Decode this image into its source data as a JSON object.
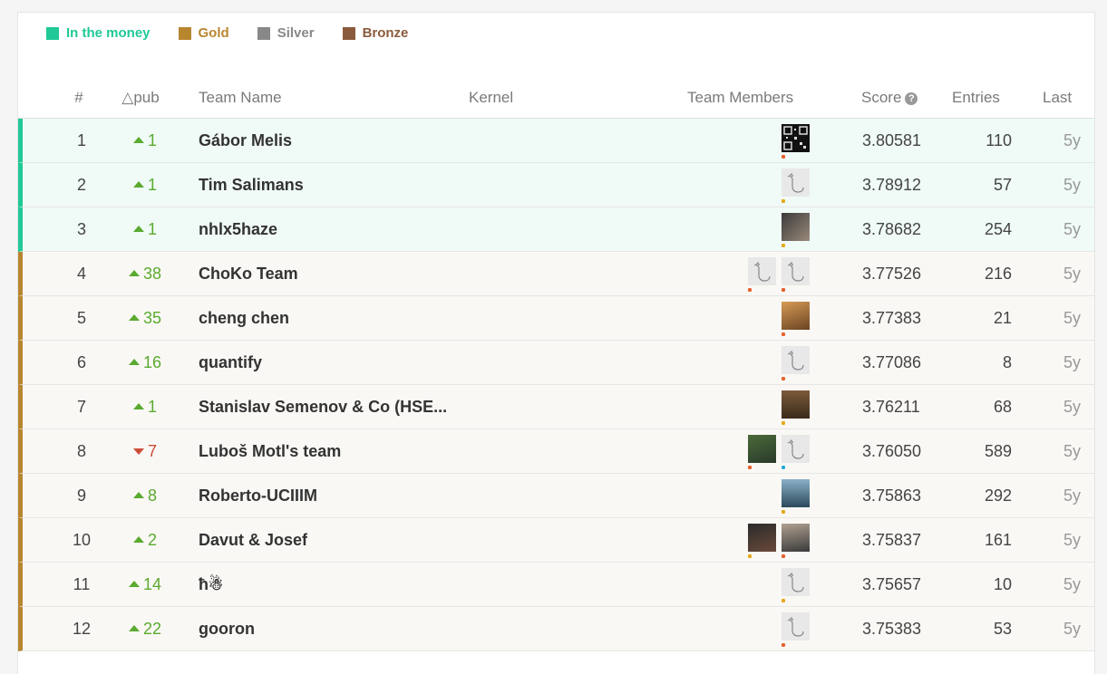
{
  "legend": [
    {
      "label": "In the money",
      "color": "#20c997"
    },
    {
      "label": "Gold",
      "color": "#b8862f"
    },
    {
      "label": "Silver",
      "color": "#888888"
    },
    {
      "label": "Bronze",
      "color": "#8b5a3c"
    }
  ],
  "header": {
    "rank": "#",
    "delta": "△pub",
    "team": "Team Name",
    "kernel": "Kernel",
    "members": "Team Members",
    "score": "Score",
    "score_help": "?",
    "entries": "Entries",
    "last": "Last"
  },
  "rows": [
    {
      "rank": "1",
      "delta": "1",
      "dir": "up",
      "team": "Gábor Melis",
      "score": "3.80581",
      "entries": "110",
      "last": "5y",
      "tier": "money",
      "avatars": [
        {
          "kind": "qr",
          "dots": "#e8602c"
        }
      ]
    },
    {
      "rank": "2",
      "delta": "1",
      "dir": "up",
      "team": "Tim Salimans",
      "score": "3.78912",
      "entries": "57",
      "last": "5y",
      "tier": "money",
      "avatars": [
        {
          "kind": "default",
          "dots": "#e6a817"
        }
      ]
    },
    {
      "rank": "3",
      "delta": "1",
      "dir": "up",
      "team": "nhlx5haze",
      "score": "3.78682",
      "entries": "254",
      "last": "5y",
      "tier": "money",
      "avatars": [
        {
          "kind": "photo1",
          "dots": "#e6a817"
        }
      ]
    },
    {
      "rank": "4",
      "delta": "38",
      "dir": "up",
      "team": "ChoKo Team",
      "score": "3.77526",
      "entries": "216",
      "last": "5y",
      "tier": "gold",
      "avatars": [
        {
          "kind": "default",
          "dots": "#e8602c"
        },
        {
          "kind": "default",
          "dots": "#e8602c"
        }
      ]
    },
    {
      "rank": "5",
      "delta": "35",
      "dir": "up",
      "team": "cheng chen",
      "score": "3.77383",
      "entries": "21",
      "last": "5y",
      "tier": "gold",
      "avatars": [
        {
          "kind": "photo2",
          "dots": "#e8602c"
        }
      ]
    },
    {
      "rank": "6",
      "delta": "16",
      "dir": "up",
      "team": "quantify",
      "score": "3.77086",
      "entries": "8",
      "last": "5y",
      "tier": "gold",
      "avatars": [
        {
          "kind": "default",
          "dots": "#e8602c"
        }
      ]
    },
    {
      "rank": "7",
      "delta": "1",
      "dir": "up",
      "team": "Stanislav Semenov & Co (HSE...",
      "score": "3.76211",
      "entries": "68",
      "last": "5y",
      "tier": "gold",
      "avatars": [
        {
          "kind": "photo3",
          "dots": "#e6a817"
        }
      ]
    },
    {
      "rank": "8",
      "delta": "7",
      "dir": "down",
      "team": "Luboš Motl's team",
      "score": "3.76050",
      "entries": "589",
      "last": "5y",
      "tier": "gold",
      "avatars": [
        {
          "kind": "photo4",
          "dots": "#e8602c"
        },
        {
          "kind": "default",
          "dots": "#20a8d8",
          "count": 2
        }
      ]
    },
    {
      "rank": "9",
      "delta": "8",
      "dir": "up",
      "team": "Roberto-UCIIIM",
      "score": "3.75863",
      "entries": "292",
      "last": "5y",
      "tier": "gold",
      "avatars": [
        {
          "kind": "photo5",
          "dots": "#e6a817"
        }
      ]
    },
    {
      "rank": "10",
      "delta": "2",
      "dir": "up",
      "team": "Davut & Josef",
      "score": "3.75837",
      "entries": "161",
      "last": "5y",
      "tier": "gold",
      "avatars": [
        {
          "kind": "photo6",
          "dots": "#e6a817"
        },
        {
          "kind": "photo7",
          "dots": "#e8602c"
        }
      ]
    },
    {
      "rank": "11",
      "delta": "14",
      "dir": "up",
      "team": "ħ☃",
      "score": "3.75657",
      "entries": "10",
      "last": "5y",
      "tier": "gold",
      "avatars": [
        {
          "kind": "default",
          "dots": "#e6a817"
        }
      ]
    },
    {
      "rank": "12",
      "delta": "22",
      "dir": "up",
      "team": "gooron",
      "score": "3.75383",
      "entries": "53",
      "last": "5y",
      "tier": "gold",
      "avatars": [
        {
          "kind": "default",
          "dots": "#e8602c"
        }
      ]
    }
  ]
}
